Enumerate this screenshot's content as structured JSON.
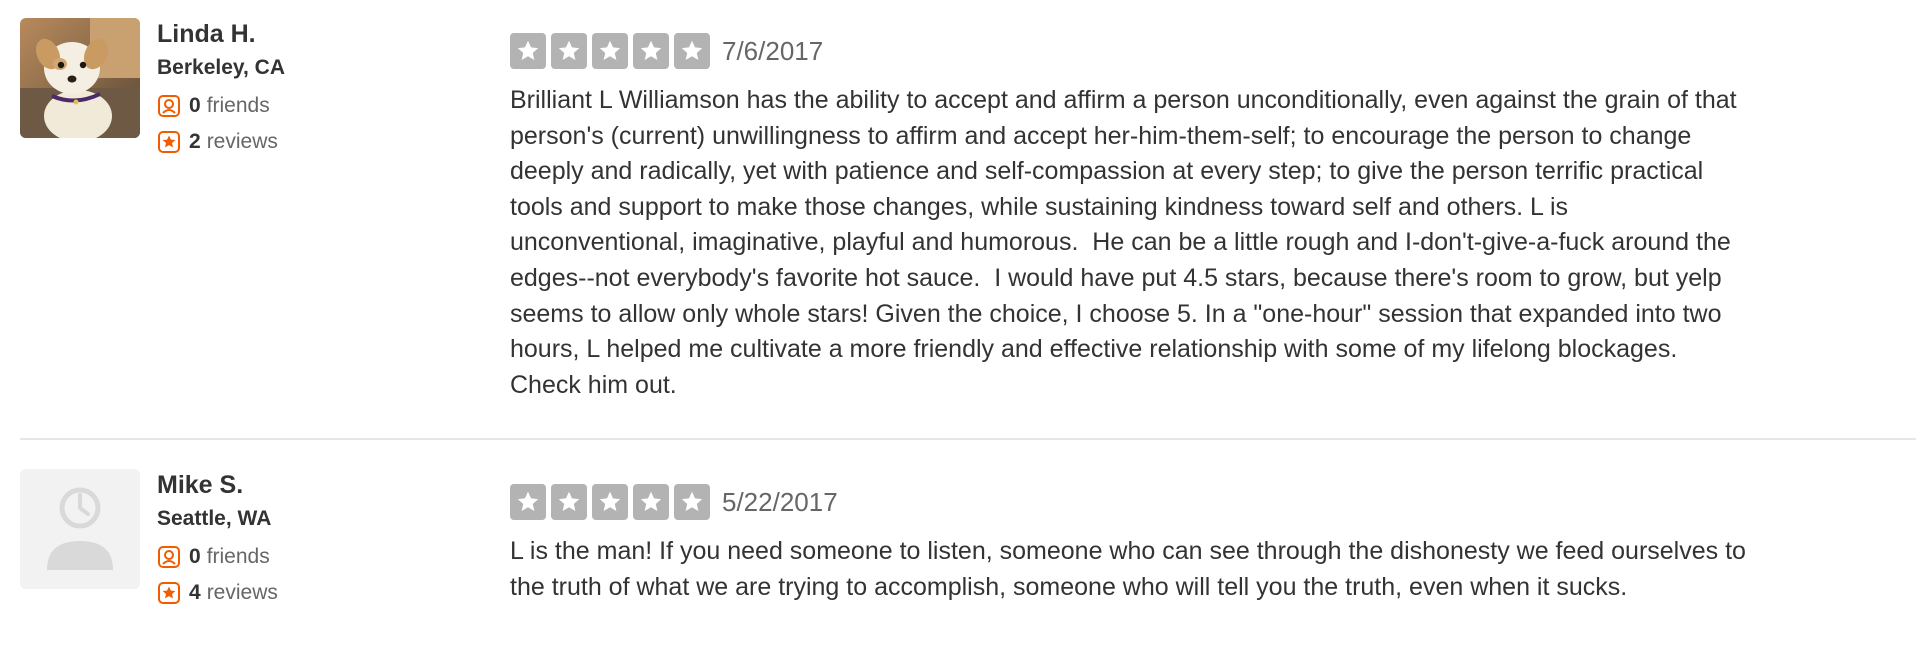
{
  "colors": {
    "text_primary": "#333333",
    "text_secondary": "#666666",
    "accent_orange": "#f15c00",
    "star_gray": "#b3b3b3",
    "divider": "#e6e6e6"
  },
  "reviews": [
    {
      "user": {
        "name": "Linda H.",
        "location": "Berkeley, CA",
        "friends_count": "0",
        "friends_label": "friends",
        "reviews_count": "2",
        "reviews_label": "reviews",
        "avatar_icon": "dog-photo-avatar"
      },
      "rating": 5,
      "date": "7/6/2017",
      "text": "Brilliant L Williamson has the ability to accept and affirm a person unconditionally, even against the grain of that\nperson's (current) unwillingness to affirm and accept her-him-them-self; to encourage the person to change\ndeeply and radically, yet with patience and self-compassion at every step; to give the person terrific practical\ntools and support to make those changes, while sustaining kindness toward self and others. L is\nunconventional, imaginative, playful and humorous.  He can be a little rough and I-don't-give-a-fuck around the\nedges--not everybody's favorite hot sauce.  I would have put 4.5 stars, because there's room to grow, but yelp\nseems to allow only whole stars! Given the choice, I choose 5. In a \"one-hour\" session that expanded into two\nhours, L helped me cultivate a more friendly and effective relationship with some of my lifelong blockages.\nCheck him out."
    },
    {
      "user": {
        "name": "Mike S.",
        "location": "Seattle, WA",
        "friends_count": "0",
        "friends_label": "friends",
        "reviews_count": "4",
        "reviews_label": "reviews",
        "avatar_icon": "default-user-avatar"
      },
      "rating": 5,
      "date": "5/22/2017",
      "text": "L is the man! If you need someone to listen, someone who can see through the dishonesty we feed ourselves to\nthe truth of what we are trying to accomplish, someone who will tell you the truth, even when it sucks."
    }
  ]
}
